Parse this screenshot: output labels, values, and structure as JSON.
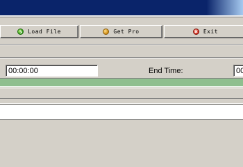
{
  "toolbar": {
    "load_file_label": "Load File",
    "get_pro_label": "Get Pro",
    "exit_label": "Exit"
  },
  "time": {
    "start_value": "00:00:00",
    "end_label": "End Time:",
    "end_value": "00"
  },
  "progress": {
    "fraction": 1.0,
    "color": "#8fbf8f"
  },
  "colors": {
    "title_bar": "#0a246a",
    "window_bg": "#d4d0c8"
  },
  "icons": {
    "load_file": "green-check-icon",
    "get_pro": "orange-coin-icon",
    "exit": "red-x-icon"
  }
}
